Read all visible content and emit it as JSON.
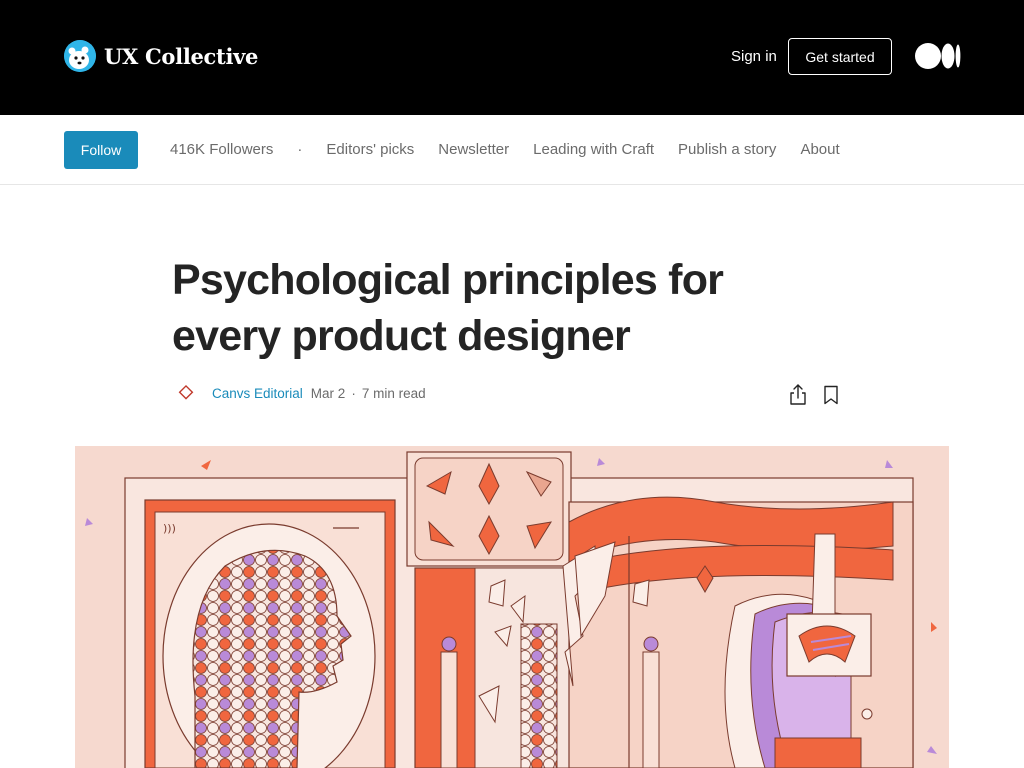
{
  "header": {
    "brand_name": "UX Collective",
    "signin_label": "Sign in",
    "get_started_label": "Get started"
  },
  "pubnav": {
    "follow_label": "Follow",
    "followers": "416K Followers",
    "separator": "·",
    "items": [
      "Editors' picks",
      "Newsletter",
      "Leading with Craft",
      "Publish a story",
      "About"
    ]
  },
  "article": {
    "title": "Psychological principles for every product designer",
    "author": "Canvs Editorial",
    "date": "Mar 2",
    "dot": "·",
    "read_time": "7 min read"
  },
  "colors": {
    "header_bg": "#000000",
    "accent": "#1a8bba",
    "brand_logo": "#2fb5e8",
    "hero_bg": "#f6d9cf",
    "hero_orange": "#f0663f",
    "hero_purple": "#b98ad8"
  },
  "icons": [
    "polar-bear-logo-icon",
    "medium-logo-icon",
    "canvs-diamond-icon",
    "share-icon",
    "bookmark-icon"
  ]
}
